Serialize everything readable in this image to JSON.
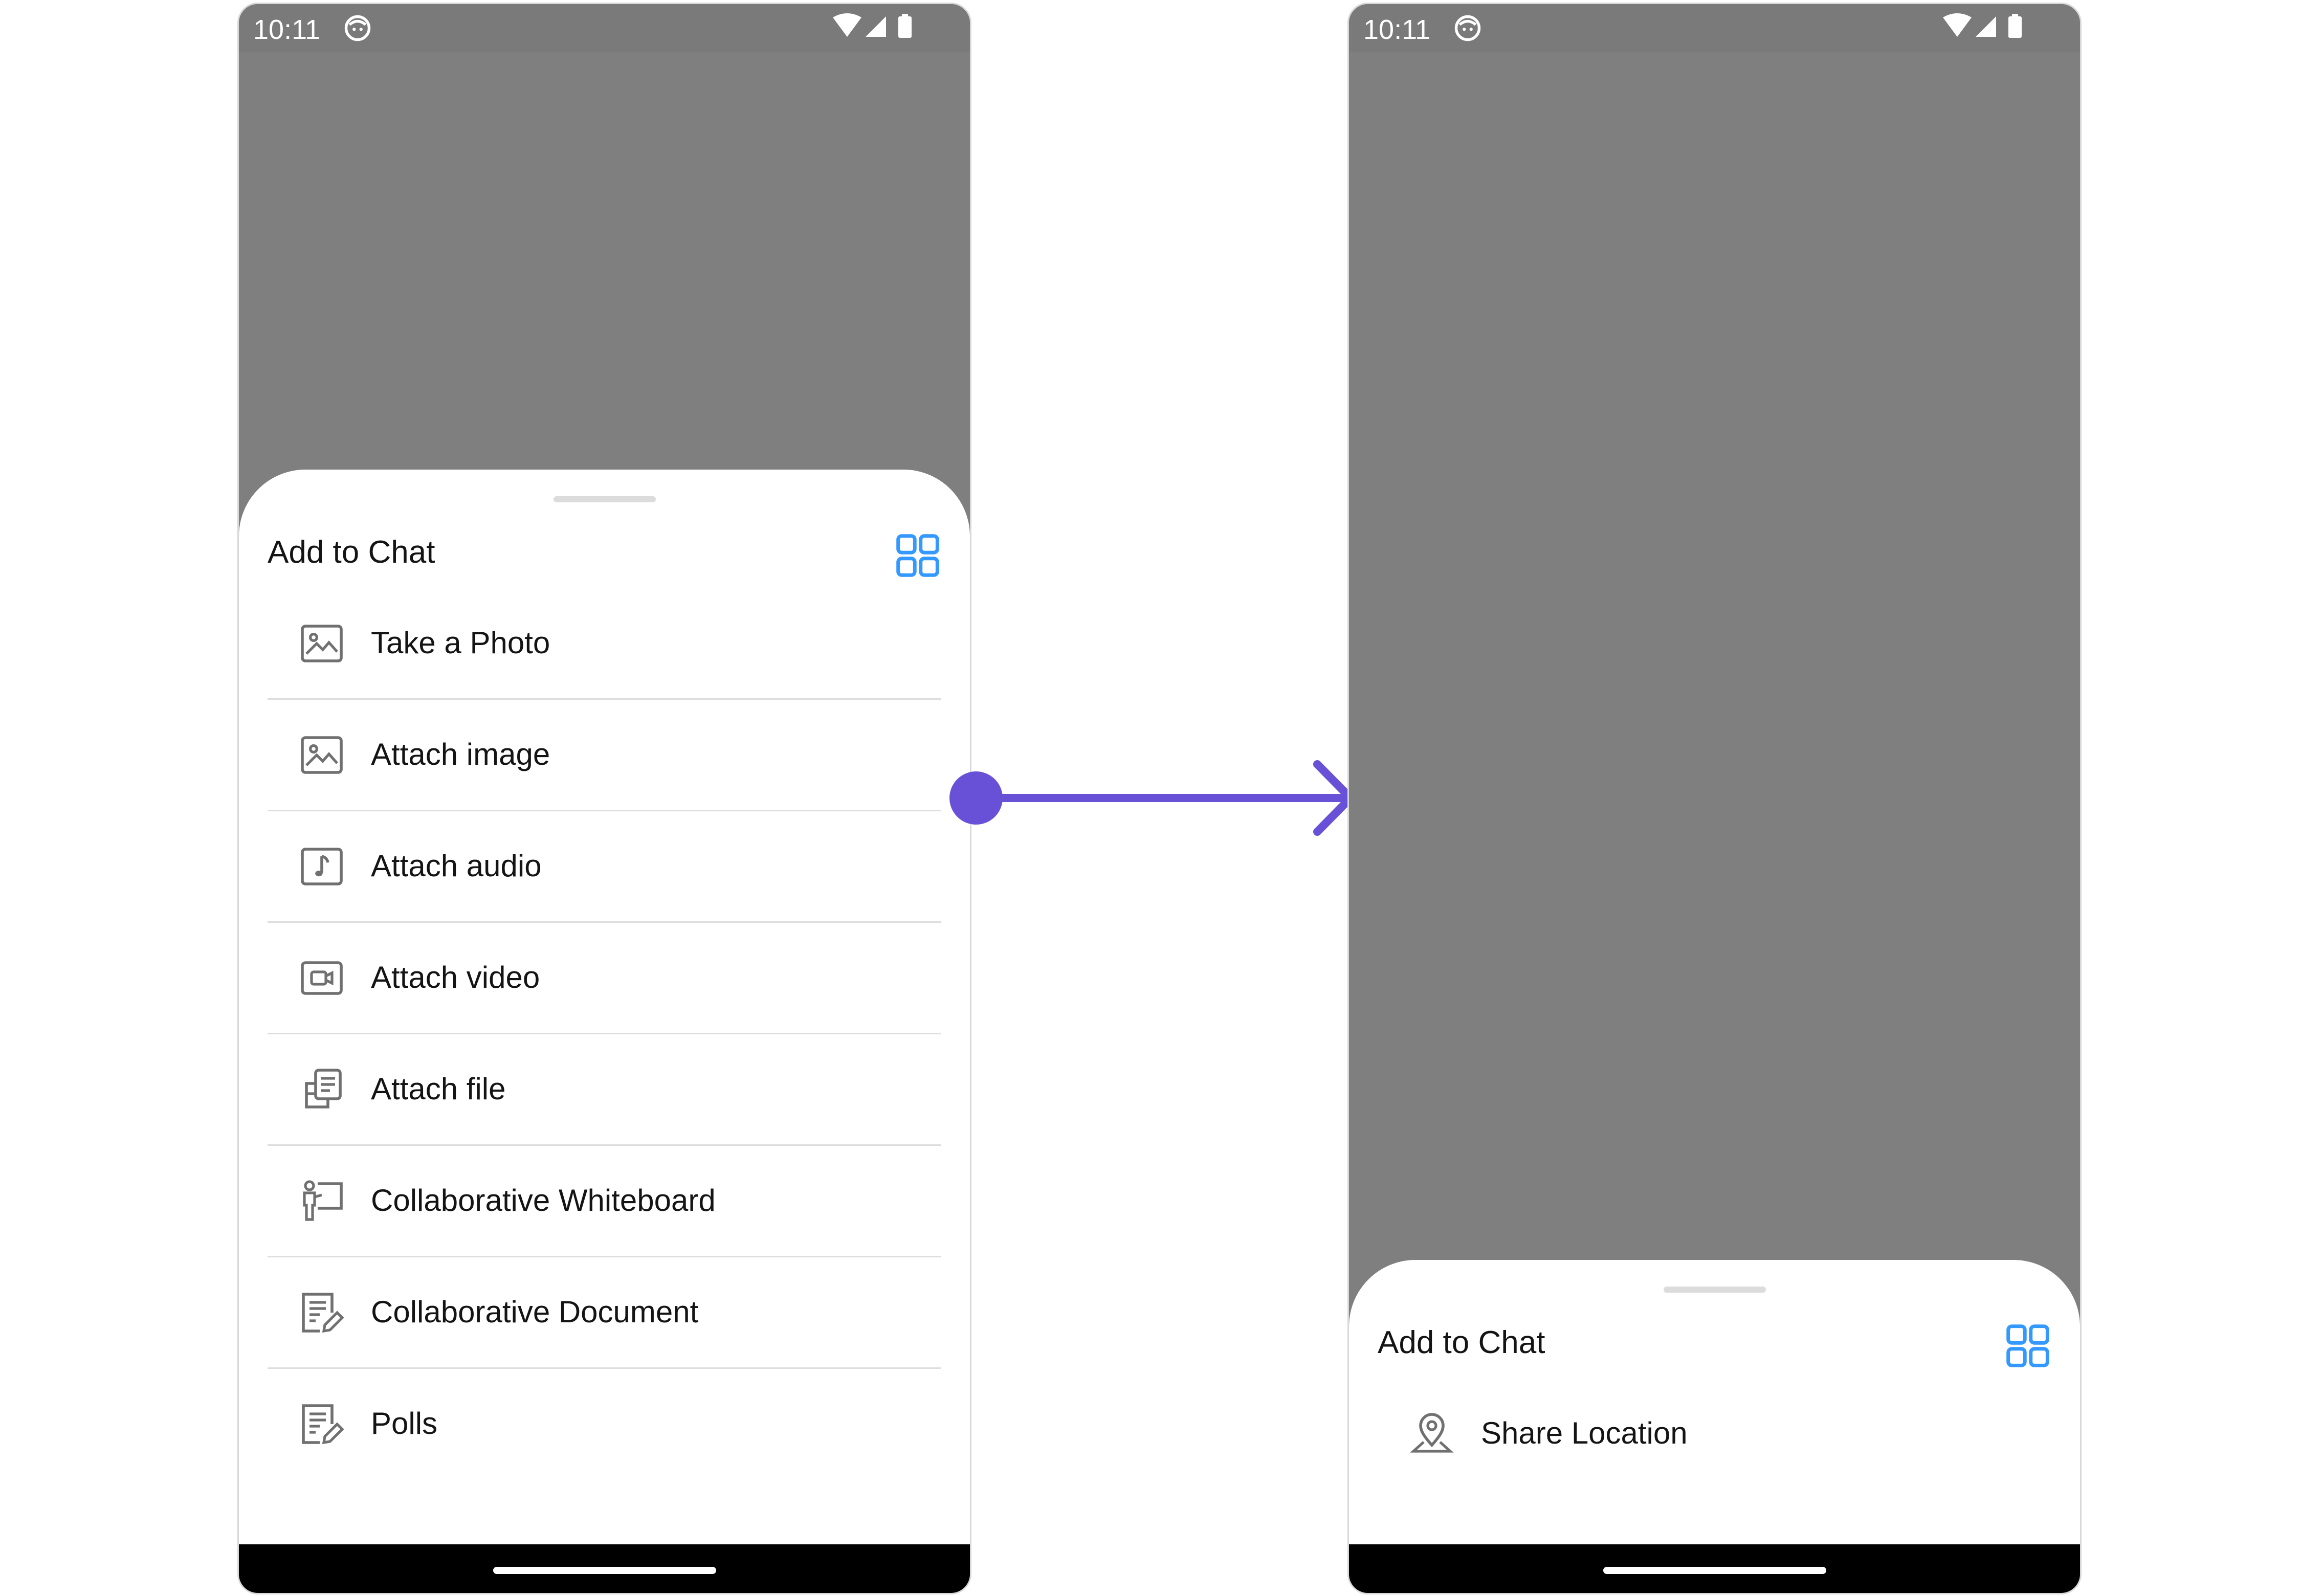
{
  "colors": {
    "accent": "#6851D6",
    "grid_icon": "#3399FF",
    "scrim": "#7F7F7F",
    "sheet": "#FFFFFF",
    "text": "#141414",
    "icon_gray": "#707070"
  },
  "left_screen": {
    "status_bar": {
      "time": "10:11",
      "icons": [
        "face-icon",
        "wifi-icon",
        "signal-icon",
        "battery-icon"
      ]
    },
    "sheet": {
      "title": "Add to Chat",
      "view_toggle_icon": "grid-icon",
      "items": [
        {
          "label": "Take a Photo",
          "icon": "image-icon"
        },
        {
          "label": "Attach image",
          "icon": "image-icon"
        },
        {
          "label": "Attach audio",
          "icon": "audio-icon"
        },
        {
          "label": "Attach video",
          "icon": "video-icon"
        },
        {
          "label": "Attach file",
          "icon": "file-icon"
        },
        {
          "label": "Collaborative Whiteboard",
          "icon": "whiteboard-icon"
        },
        {
          "label": "Collaborative Document",
          "icon": "document-icon"
        },
        {
          "label": "Polls",
          "icon": "polls-icon"
        }
      ]
    }
  },
  "right_screen": {
    "status_bar": {
      "time": "10:11",
      "icons": [
        "face-icon",
        "wifi-icon",
        "signal-icon",
        "battery-icon"
      ]
    },
    "sheet": {
      "title": "Add to Chat",
      "view_toggle_icon": "grid-icon",
      "items": [
        {
          "label": "Share Location",
          "icon": "location-pin-icon"
        }
      ]
    }
  }
}
